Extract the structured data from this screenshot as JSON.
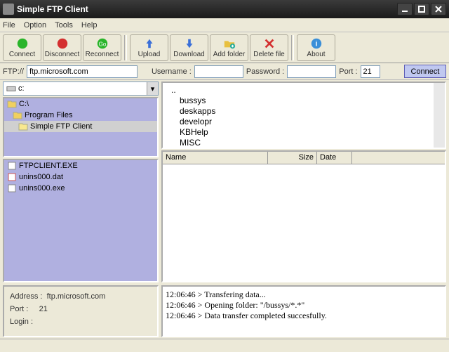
{
  "window": {
    "title": "Simple FTP Client"
  },
  "menu": [
    "File",
    "Option",
    "Tools",
    "Help"
  ],
  "toolbar": {
    "connect": "Connect",
    "disconnect": "Disconnect",
    "reconnect": "Reconnect",
    "upload": "Upload",
    "download": "Download",
    "addfolder": "Add folder",
    "deletefile": "Delete file",
    "about": "About"
  },
  "addr": {
    "ftp_label": "FTP://",
    "ftp_value": "ftp.microsoft.com",
    "user_label": "Username :",
    "user_value": "",
    "pass_label": "Password :",
    "pass_value": "",
    "port_label": "Port :",
    "port_value": "21",
    "connect_btn": "Connect"
  },
  "drive": {
    "label": "c:"
  },
  "tree": [
    "C:\\",
    "Program Files",
    "Simple FTP Client"
  ],
  "localfiles": [
    "FTPCLIENT.EXE",
    "unins000.dat",
    "unins000.exe"
  ],
  "remote": [
    "..",
    "bussys",
    "deskapps",
    "developr",
    "KBHelp",
    "MISC"
  ],
  "cols": {
    "name": "Name",
    "size": "Size",
    "date": "Date"
  },
  "info": {
    "addr_label": "Address :",
    "addr_value": "ftp.microsoft.com",
    "port_label": "Port :",
    "port_value": "21",
    "login_label": "Login :",
    "login_value": ""
  },
  "log": [
    "12:06:46 > Transfering data...",
    "12:06:46 > Opening folder: \"/bussys/*.*\"",
    "12:06:46 > Data transfer completed succesfully."
  ]
}
